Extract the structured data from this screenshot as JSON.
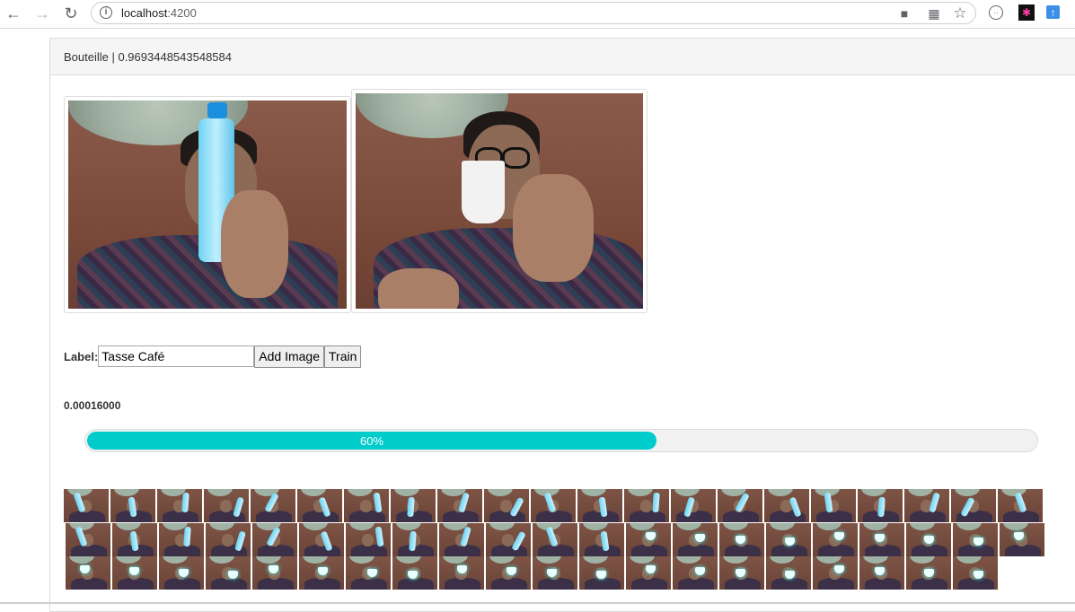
{
  "browser": {
    "url_host": "localhost",
    "url_port": ":4200"
  },
  "panel": {
    "heading": "Bouteille | 0.9693448543548584"
  },
  "form": {
    "label": "Label:",
    "input_value": "Tasse Café",
    "add_button": "Add Image",
    "train_button": "Train"
  },
  "training": {
    "loss": "0.00016000",
    "progress_label": "60%",
    "progress_fraction": 0.6
  },
  "thumbnails": {
    "row_counts": [
      21,
      21,
      20
    ]
  }
}
